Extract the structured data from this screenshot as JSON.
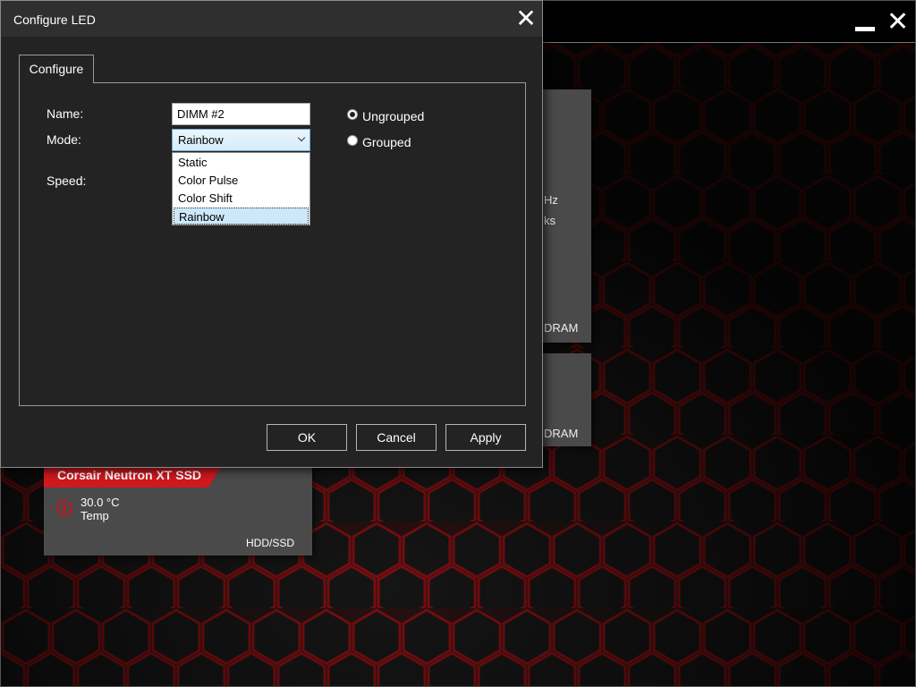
{
  "background_app": {
    "card_text_1": "Hz",
    "card_text_2": "ks",
    "card_type_1": "DRAM",
    "card_type_2": "DRAM",
    "ssd_card": {
      "title": "Corsair Neutron XT SSD",
      "temperature": "30.0 °C",
      "temperature_label": "Temp",
      "device_type": "HDD/SSD"
    },
    "accent_color": "#d0181f"
  },
  "dialog": {
    "title": "Configure LED",
    "tab_label": "Configure",
    "fields": {
      "name_label": "Name:",
      "name_value": "DIMM #2",
      "mode_label": "Mode:",
      "mode_value": "Rainbow",
      "speed_label": "Speed:"
    },
    "mode_options": [
      "Static",
      "Color Pulse",
      "Color Shift",
      "Rainbow"
    ],
    "selected_mode": "Rainbow",
    "grouping": {
      "ungrouped_label": "Ungrouped",
      "grouped_label": "Grouped",
      "selected": "Ungrouped"
    },
    "buttons": {
      "ok": "OK",
      "cancel": "Cancel",
      "apply": "Apply"
    }
  },
  "icons": [
    "close-icon",
    "minimize-icon",
    "chevron-down-icon",
    "temperature-icon"
  ]
}
